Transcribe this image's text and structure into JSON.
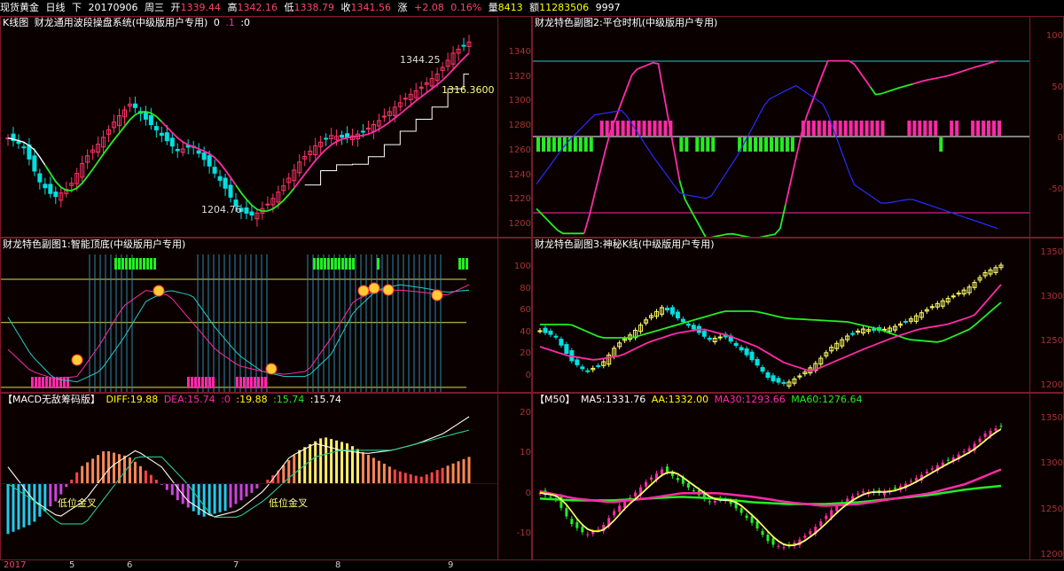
{
  "top": {
    "instrument": "现货黄金",
    "period": "日线",
    "nav": "下",
    "date": "20170906",
    "weekday": "周三",
    "open_label": "开",
    "open": "1339.44",
    "high_label": "高",
    "high": "1342.16",
    "low_label": "低",
    "low": "1338.79",
    "close_label": "收",
    "close": "1341.56",
    "change_label": "涨",
    "change": "+2.08",
    "change_pct": "0.16%",
    "vol_label": "量",
    "vol": "8413",
    "amt_label": "额",
    "amt": "11283506",
    "extra": "9997"
  },
  "panels": {
    "kline": {
      "title": "K线图",
      "indicator": "财龙通用波段操盘系统(中级版用户专用)",
      "p1": "0",
      "p2": ".1",
      "p3": ":0",
      "ticks": [
        "1340",
        "1320",
        "1300",
        "1280",
        "1260",
        "1240",
        "1220",
        "1200"
      ],
      "lbl_high": "1344.25",
      "lbl_mid": "1316.3600",
      "lbl_low": "1204.76"
    },
    "sub2": {
      "title": "财龙特色副图2:平仓时机(中级版用户专用)",
      "ticks": [
        "100",
        "50",
        "0",
        "-50"
      ]
    },
    "sub1": {
      "title": "财龙特色副图1:智能顶底(中级版用户专用)",
      "ticks": [
        "100",
        "80",
        "60",
        "40",
        "20",
        "0"
      ]
    },
    "sub3": {
      "title": "财龙特色副图3:神秘K线(中级版用户专用)",
      "ticks": [
        "1350",
        "1300",
        "1250",
        "1200"
      ]
    },
    "macd": {
      "title": "【MACD无敌筹码版】",
      "diff": "DIFF:19.88",
      "dea": "DEA:15.74",
      "v0": ":0",
      "v1": ":19.88",
      "v2": ":15.74",
      "v3": ":15.74",
      "ticks": [
        "20",
        "10",
        "0",
        "-10"
      ],
      "cross1": "低位金叉",
      "cross2": "低位金叉"
    },
    "ma": {
      "title": "【M50】",
      "ma5": "MA5:1331.76",
      "aa": "AA:1332.00",
      "ma30": "MA30:1293.66",
      "ma60": "MA60:1276.64",
      "ticks": [
        "1350",
        "1300",
        "1250",
        "1200"
      ]
    }
  },
  "xdates": {
    "year": "2017",
    "m5": "5",
    "m6": "6",
    "m7": "7",
    "m8": "8",
    "m9": "9"
  },
  "colors": {
    "up": "#ff3366",
    "down": "#00e0e0",
    "green": "#22ee22",
    "magenta": "#ff2aa8",
    "yellow": "#ffff00",
    "blue": "#2a2aff",
    "bg": "#0a0000",
    "frame": "#7a1a2a"
  }
}
